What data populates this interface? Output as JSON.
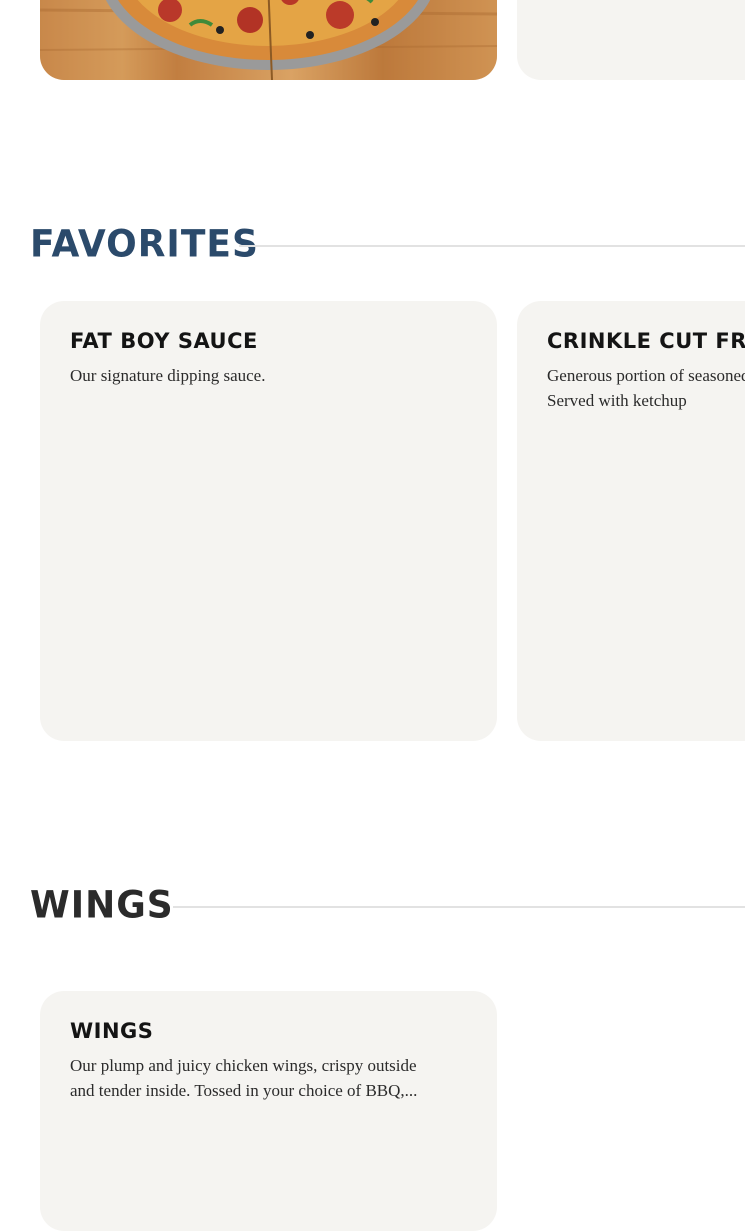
{
  "sections": {
    "favorites": {
      "title": "FAVORITES",
      "color": "#2b4a6b"
    },
    "wings": {
      "title": "WINGS",
      "color": "#2b2b2b"
    }
  },
  "items": {
    "fat_boy_sauce": {
      "title": "FAT BOY SAUCE",
      "desc_line1": "Our signature dipping sauce."
    },
    "crinkle_cut_fries": {
      "title": "CRINKLE CUT FRIES",
      "desc_line1": "Generous portion of seasoned",
      "desc_line2": "Served with ketchup"
    },
    "wings": {
      "title": "WINGS",
      "desc_line1": "Our plump and juicy chicken wings, crispy outside",
      "desc_line2": "and tender inside. Tossed in your choice of BBQ,..."
    }
  },
  "images": {
    "top_card": "pizza-photo"
  }
}
